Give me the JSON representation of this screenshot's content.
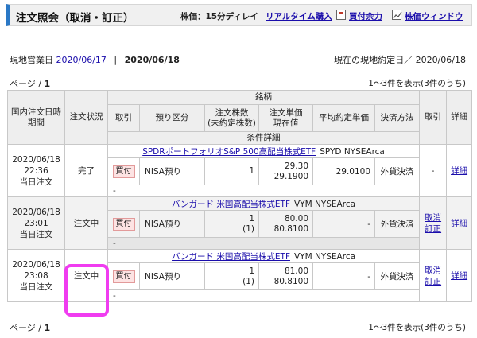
{
  "header": {
    "title": "注文照会（取消・訂正）",
    "price_note": "株価：15分ディレイ",
    "realtime_link": "リアルタイム購入",
    "yoryoku_link": "買付余力",
    "window_link": "株価ウィンドウ"
  },
  "dates": {
    "business_day_label": "現地営業日",
    "business_day_from": "2020/06/17",
    "separator": "|",
    "business_day_to": "2020/06/18",
    "contract_label": "現在の現地約定日／",
    "contract_date": "2020/06/18"
  },
  "pager": {
    "page_label": "ページ / ",
    "page_number": "1",
    "count_text": "1～3件を表示(3件のうち)"
  },
  "table": {
    "headers": {
      "order_datetime": "国内注文日時\n期間",
      "status": "注文状況",
      "brand": "銘柄",
      "trade": "取引",
      "custody": "預り区分",
      "quantity": "注文株数\n(未約定株数)",
      "unit_price": "注文単価\n現在値",
      "avg_price": "平均約定単価",
      "settlement": "決済方法",
      "action": "取引",
      "detail": "詳細",
      "condition": "条件詳細"
    },
    "rows": [
      {
        "date": "2020/06/18",
        "time": "22:36",
        "period": "当日注文",
        "status": "完了",
        "brand_name": "SPDRポートフォリオS&P 500高配当株式ETF",
        "brand_code": "SPYD NYSEArca",
        "trade": "買付",
        "custody": "NISA預り",
        "quantity": "1",
        "unfilled": "",
        "order_price": "29.30",
        "current_price": "29.1900",
        "avg_price": "29.0100",
        "settlement": "外貨決済",
        "action_text": "-",
        "cancel_link": "",
        "modify_link": "",
        "detail_link": "詳細",
        "condition": "-"
      },
      {
        "date": "2020/06/18",
        "time": "23:01",
        "period": "当日注文",
        "status": "注文中",
        "brand_name": "バンガード 米国高配当株式ETF",
        "brand_code": "VYM NYSEArca",
        "trade": "買付",
        "custody": "NISA預り",
        "quantity": "1",
        "unfilled": "(1)",
        "order_price": "80.00",
        "current_price": "80.8100",
        "avg_price": "-",
        "settlement": "外貨決済",
        "action_text": "",
        "cancel_link": "取消",
        "modify_link": "訂正",
        "detail_link": "詳細",
        "condition": "-"
      },
      {
        "date": "2020/06/18",
        "time": "23:08",
        "period": "当日注文",
        "status": "注文中",
        "brand_name": "バンガード 米国高配当株式ETF",
        "brand_code": "VYM NYSEArca",
        "trade": "買付",
        "custody": "NISA預り",
        "quantity": "1",
        "unfilled": "(1)",
        "order_price": "81.00",
        "current_price": "80.8100",
        "avg_price": "-",
        "settlement": "外貨決済",
        "action_text": "",
        "cancel_link": "取消",
        "modify_link": "訂正",
        "detail_link": "詳細",
        "condition": "-"
      }
    ]
  },
  "colors": {
    "accent_bar": "#2a78c6",
    "highlight_box": "#f03cf0",
    "buy_badge_bg": "#fde3e3"
  }
}
